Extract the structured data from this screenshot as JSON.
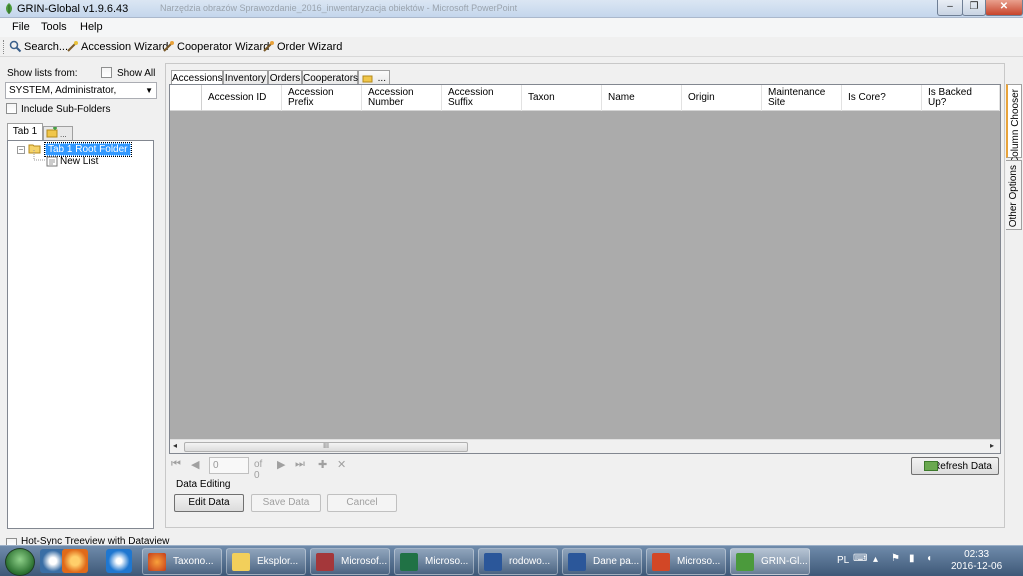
{
  "window": {
    "title": "GRIN-Global v1.9.6.43",
    "background_title": "Narzędzia obrazów   Sprawozdanie_2016_inwentaryzacja obiektów - Microsoft PowerPoint"
  },
  "menu": {
    "items": [
      "File",
      "Tools",
      "Help"
    ]
  },
  "toolbar": {
    "search": "Search...",
    "accession_wizard": "Accession Wizard",
    "cooperator_wizard": "Cooperator Wizard",
    "order_wizard": "Order Wizard"
  },
  "left": {
    "show_lists_from": "Show lists from:",
    "show_all": "Show All",
    "owner_value": "SYSTEM, Administrator,",
    "include_subfolders": "Include Sub-Folders",
    "tab": "Tab 1",
    "tab_add": "...",
    "tree_root": "Tab 1 Root Folder",
    "tree_child": "New List",
    "hotsync": "Hot-Sync Treeview with Dataview"
  },
  "grid": {
    "tabs": [
      "Accessions",
      "Inventory",
      "Orders",
      "Cooperators",
      "..."
    ],
    "columns": [
      [
        "Accession ID"
      ],
      [
        "Accession",
        "Prefix"
      ],
      [
        "Accession",
        "Number"
      ],
      [
        "Accession",
        "Suffix"
      ],
      [
        "Taxon"
      ],
      [
        "Name"
      ],
      [
        "Origin"
      ],
      [
        "Maintenance",
        "Site"
      ],
      [
        "Is Core?"
      ],
      [
        "Is Backed",
        "Up?"
      ]
    ],
    "scroll_grip": "III"
  },
  "nav": {
    "position": "0",
    "of_total": "of 0"
  },
  "actions": {
    "refresh": "Refresh Data",
    "data_editing": "Data Editing",
    "edit": "Edit Data",
    "save": "Save Data",
    "cancel": "Cancel"
  },
  "side_tabs": [
    "Column Chooser",
    "Other Options"
  ],
  "taskbar": {
    "tasks": [
      "Taxono...",
      "Eksplor...",
      "Microsof...",
      "Microso...",
      "rodowo...",
      "Dane pa...",
      "Microso...",
      "GRIN-Gl..."
    ],
    "lang": "PL",
    "time": "02:33",
    "date": "2016-12-06"
  },
  "colors": {
    "selection": "#3399ff",
    "grid_background": "#ababab",
    "taskbar": "#4d6a8c"
  }
}
